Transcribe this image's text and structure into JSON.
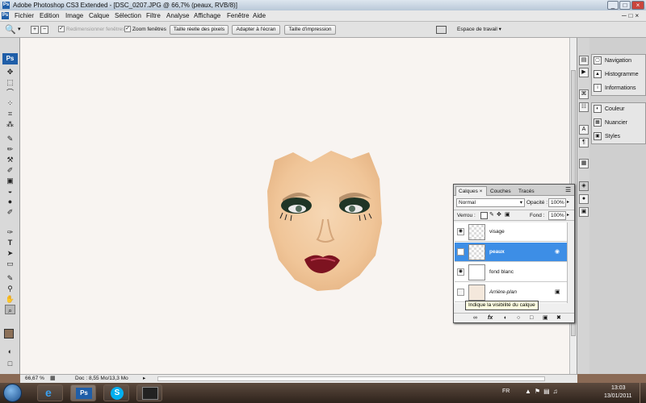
{
  "window": {
    "title": "Adobe Photoshop CS3 Extended - [DSC_0207.JPG @ 66,7% (peaux, RVB/8)]",
    "app_icon": "Ps",
    "controls": [
      "_",
      "□",
      "×"
    ]
  },
  "menu": [
    "Fichier",
    "Edition",
    "Image",
    "Calque",
    "Sélection",
    "Filtre",
    "Analyse",
    "Affichage",
    "Fenêtre",
    "Aide"
  ],
  "options": {
    "resize_windows": "Redimensionner fenêtres",
    "zoom_windows": "Zoom fenêtres",
    "actual_pixels": "Taille réelle des pixels",
    "fit_screen": "Adapter à l'écran",
    "print_size": "Taille d'impression",
    "workspace": "Espace de travail ▾"
  },
  "toolbox": {
    "logo": "Ps",
    "tools": [
      "✥",
      "⬚",
      "⌒",
      "⁘",
      "⌗",
      "⁂",
      "✎",
      "✏",
      "⚒",
      "✐",
      "▣",
      "◒",
      "●",
      "✐",
      "T",
      "➤",
      "▭",
      "✋",
      "✲",
      "⌕",
      "□"
    ]
  },
  "right_strip": [
    "▤",
    "▶",
    "⌘",
    "☷",
    "A",
    "¶",
    "▦",
    "◈",
    "●",
    "▣"
  ],
  "dock": {
    "group1": [
      "Navigation",
      "Histogramme",
      "Informations"
    ],
    "group2": [
      "Couleur",
      "Nuancier",
      "Styles"
    ]
  },
  "layers_panel": {
    "tabs": [
      "Calques",
      "Couches",
      "Tracés"
    ],
    "blend_mode": "Normal",
    "opacity_label": "Opacité :",
    "opacity": "100%",
    "lock_label": "Verrou :",
    "fill_label": "Fond :",
    "fill": "100%",
    "layers": [
      {
        "name": "visage"
      },
      {
        "name": "peaux"
      },
      {
        "name": "fond blanc"
      },
      {
        "name": "Arrière-plan"
      }
    ],
    "tooltip": "Indique la visibilité du calque",
    "footer_icons": [
      "∞",
      "fx",
      "◐",
      "○",
      "□",
      "▣",
      "✖"
    ]
  },
  "status": {
    "zoom": "66,67 %",
    "doc": "Doc : 8,55 Mo/13,3 Mo"
  },
  "taskbar": {
    "lang": "FR",
    "time": "13:03",
    "date": "13/01/2011",
    "ps_label": "Ps",
    "skype_label": "S"
  }
}
